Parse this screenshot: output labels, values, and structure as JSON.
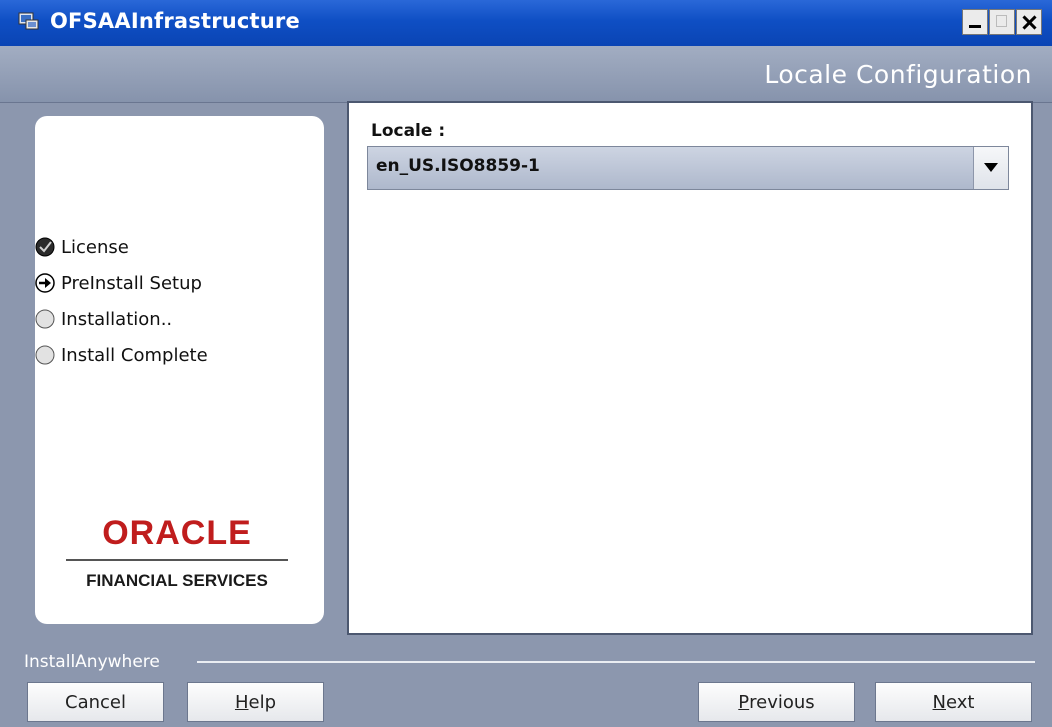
{
  "window": {
    "title": "OFSAAInfrastructure",
    "heading": "Locale Configuration"
  },
  "steps": [
    {
      "label": "License",
      "state": "completed",
      "icon": "check-circle-icon"
    },
    {
      "label": "PreInstall Setup",
      "state": "current",
      "icon": "arrow-circle-icon"
    },
    {
      "label": "Installation..",
      "state": "pending",
      "icon": "empty-circle-icon"
    },
    {
      "label": "Install Complete",
      "state": "pending",
      "icon": "empty-circle-icon"
    }
  ],
  "logo": {
    "wordmark": "ORACLE",
    "subtitle": "FINANCIAL SERVICES"
  },
  "form": {
    "locale_label": "Locale :",
    "locale_value": "en_US.ISO8859-1"
  },
  "footer": {
    "brand": "InstallAnywhere",
    "cancel": "Cancel",
    "help_mnemonic": "H",
    "help_rest": "elp",
    "previous_mnemonic": "P",
    "previous_rest": "revious",
    "next_mnemonic": "N",
    "next_rest": "ext"
  },
  "colors": {
    "titlebar": "#0f4fc4",
    "background": "#8c97ae",
    "oracle_red": "#c01d1d"
  }
}
